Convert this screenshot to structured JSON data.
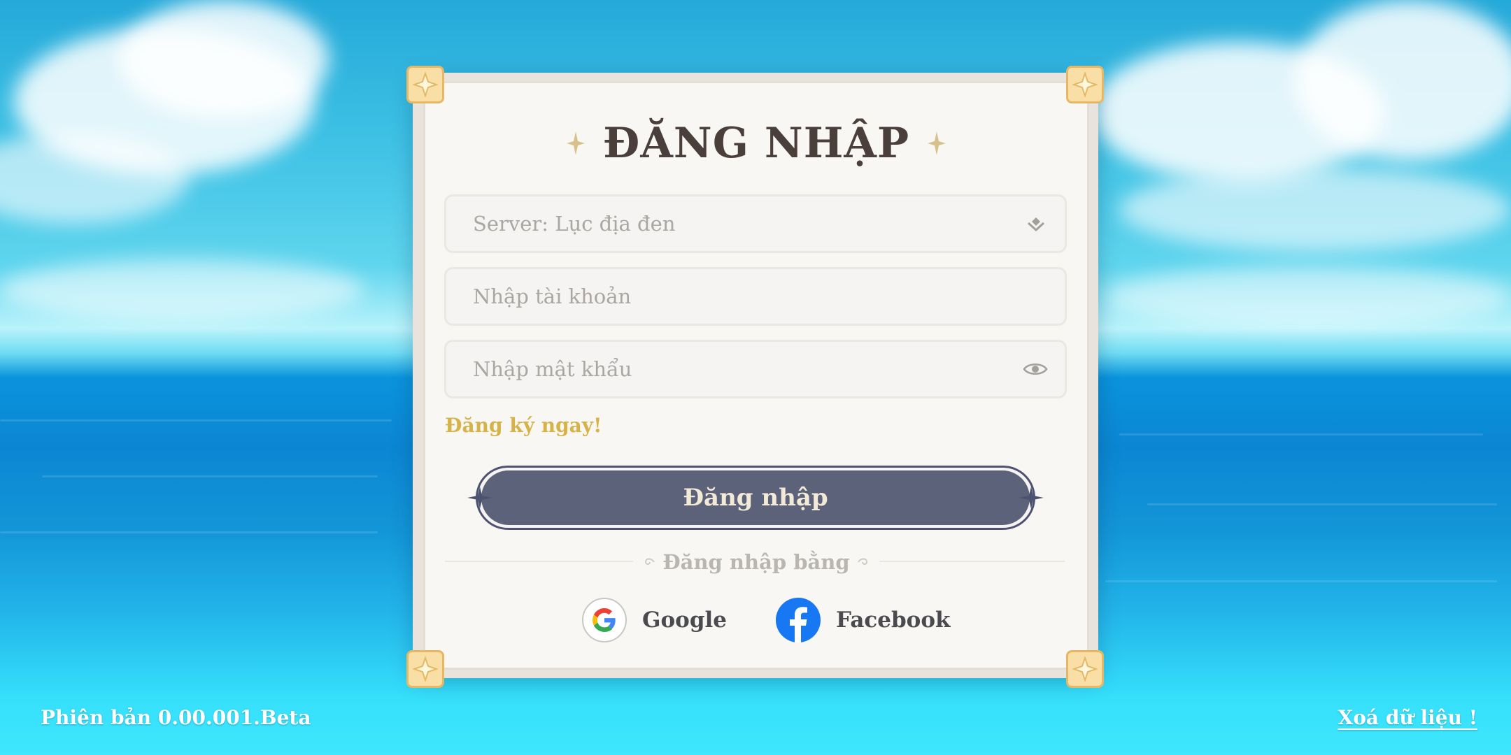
{
  "login": {
    "title": "ĐĂNG NHẬP",
    "server_label": "Server: Lục địa đen",
    "account_placeholder": "Nhập tài khoản",
    "password_placeholder": "Nhập mật khẩu",
    "register_link": "Đăng ký ngay!",
    "submit_label": "Đăng nhập",
    "alt_login_label": "Đăng nhập bằng",
    "social": [
      {
        "label": "Google",
        "icon": "google-logo-icon"
      },
      {
        "label": "Facebook",
        "icon": "facebook-logo-icon"
      }
    ]
  },
  "footer": {
    "version": "Phiên bản 0.00.001.Beta",
    "clear_data": "Xoá dữ liệu !"
  },
  "icons": {
    "server_select": "chevron-down-icon",
    "password_toggle": "eye-icon",
    "title_ornament": "sparkle-icon",
    "panel_corner": "star-corner-icon"
  },
  "colors": {
    "title": "#4b3f3b",
    "register_link": "#d6b247",
    "button_fill": "#5c6279",
    "button_text": "#f2e9d6",
    "corner_gold": "#f9dfa6",
    "facebook_blue": "#1877f2"
  }
}
